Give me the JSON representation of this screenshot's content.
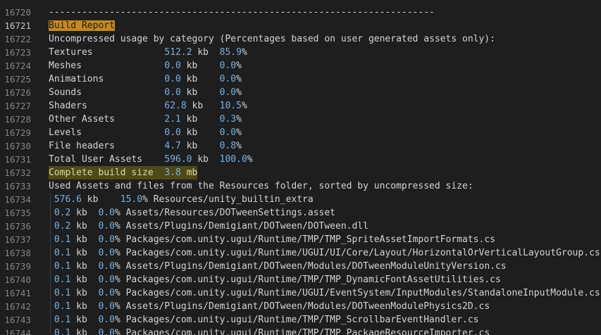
{
  "editor": {
    "lines": [
      {
        "n": "16720",
        "segments": [
          {
            "t": "----------------------------------------------------------------------",
            "c": "plain"
          }
        ]
      },
      {
        "n": "16721",
        "active": true,
        "segments": [
          {
            "t": "Build Report",
            "c": "highlight-word"
          }
        ]
      },
      {
        "n": "16722",
        "segments": [
          {
            "t": "Uncompressed usage by category (Percentages based on user generated assets only):",
            "c": "plain"
          }
        ]
      },
      {
        "n": "16723",
        "segments": [
          {
            "t": "Textures             ",
            "c": "plain"
          },
          {
            "t": "512.2",
            "c": "num"
          },
          {
            "t": " kb  ",
            "c": "plain"
          },
          {
            "t": "85.9",
            "c": "pct"
          },
          {
            "t": "%",
            "c": "plain"
          }
        ]
      },
      {
        "n": "16724",
        "segments": [
          {
            "t": "Meshes               ",
            "c": "plain"
          },
          {
            "t": "0.0",
            "c": "num"
          },
          {
            "t": " kb    ",
            "c": "plain"
          },
          {
            "t": "0.0",
            "c": "pct"
          },
          {
            "t": "%",
            "c": "plain"
          }
        ]
      },
      {
        "n": "16725",
        "segments": [
          {
            "t": "Animations           ",
            "c": "plain"
          },
          {
            "t": "0.0",
            "c": "num"
          },
          {
            "t": " kb    ",
            "c": "plain"
          },
          {
            "t": "0.0",
            "c": "pct"
          },
          {
            "t": "%",
            "c": "plain"
          }
        ]
      },
      {
        "n": "16726",
        "segments": [
          {
            "t": "Sounds               ",
            "c": "plain"
          },
          {
            "t": "0.0",
            "c": "num"
          },
          {
            "t": " kb    ",
            "c": "plain"
          },
          {
            "t": "0.0",
            "c": "pct"
          },
          {
            "t": "%",
            "c": "plain"
          }
        ]
      },
      {
        "n": "16727",
        "segments": [
          {
            "t": "Shaders              ",
            "c": "plain"
          },
          {
            "t": "62.8",
            "c": "num"
          },
          {
            "t": " kb   ",
            "c": "plain"
          },
          {
            "t": "10.5",
            "c": "pct"
          },
          {
            "t": "%",
            "c": "plain"
          }
        ]
      },
      {
        "n": "16728",
        "segments": [
          {
            "t": "Other Assets         ",
            "c": "plain"
          },
          {
            "t": "2.1",
            "c": "num"
          },
          {
            "t": " kb    ",
            "c": "plain"
          },
          {
            "t": "0.3",
            "c": "pct"
          },
          {
            "t": "%",
            "c": "plain"
          }
        ]
      },
      {
        "n": "16729",
        "segments": [
          {
            "t": "Levels               ",
            "c": "plain"
          },
          {
            "t": "0.0",
            "c": "num"
          },
          {
            "t": " kb    ",
            "c": "plain"
          },
          {
            "t": "0.0",
            "c": "pct"
          },
          {
            "t": "%",
            "c": "plain"
          }
        ]
      },
      {
        "n": "16730",
        "segments": [
          {
            "t": "File headers         ",
            "c": "plain"
          },
          {
            "t": "4.7",
            "c": "num"
          },
          {
            "t": " kb    ",
            "c": "plain"
          },
          {
            "t": "0.8",
            "c": "pct"
          },
          {
            "t": "%",
            "c": "plain"
          }
        ]
      },
      {
        "n": "16731",
        "segments": [
          {
            "t": "Total User Assets    ",
            "c": "plain"
          },
          {
            "t": "596.0",
            "c": "num"
          },
          {
            "t": " kb  ",
            "c": "plain"
          },
          {
            "t": "100.0",
            "c": "pct"
          },
          {
            "t": "%",
            "c": "plain"
          }
        ]
      },
      {
        "n": "16732",
        "find": true,
        "segments": [
          {
            "t": "Complete build size  ",
            "c": "yellowtxt"
          },
          {
            "t": "3.8",
            "c": "num"
          },
          {
            "t": " mb",
            "c": "yellowtxt"
          }
        ]
      },
      {
        "n": "16733",
        "segments": [
          {
            "t": "Used Assets and files from the Resources folder, sorted by uncompressed size:",
            "c": "plain"
          }
        ]
      },
      {
        "n": "16734",
        "segments": [
          {
            "t": " ",
            "c": "plain"
          },
          {
            "t": "576.6",
            "c": "num"
          },
          {
            "t": " kb    ",
            "c": "plain"
          },
          {
            "t": "15.0",
            "c": "pct"
          },
          {
            "t": "% Resources/unity_builtin_extra",
            "c": "plain"
          }
        ]
      },
      {
        "n": "16735",
        "segments": [
          {
            "t": " ",
            "c": "plain"
          },
          {
            "t": "0.2",
            "c": "num"
          },
          {
            "t": " kb  ",
            "c": "plain"
          },
          {
            "t": "0.0",
            "c": "pct"
          },
          {
            "t": "% Assets/Resources/DOTweenSettings.asset",
            "c": "plain"
          }
        ]
      },
      {
        "n": "16736",
        "segments": [
          {
            "t": " ",
            "c": "plain"
          },
          {
            "t": "0.2",
            "c": "num"
          },
          {
            "t": " kb  ",
            "c": "plain"
          },
          {
            "t": "0.0",
            "c": "pct"
          },
          {
            "t": "% Assets/Plugins/Demigiant/DOTween/DOTween.dll",
            "c": "plain"
          }
        ]
      },
      {
        "n": "16737",
        "segments": [
          {
            "t": " ",
            "c": "plain"
          },
          {
            "t": "0.1",
            "c": "num"
          },
          {
            "t": " kb  ",
            "c": "plain"
          },
          {
            "t": "0.0",
            "c": "pct"
          },
          {
            "t": "% Packages/com.unity.ugui/Runtime/TMP/TMP_SpriteAssetImportFormats.cs",
            "c": "plain"
          }
        ]
      },
      {
        "n": "16738",
        "segments": [
          {
            "t": " ",
            "c": "plain"
          },
          {
            "t": "0.1",
            "c": "num"
          },
          {
            "t": " kb  ",
            "c": "plain"
          },
          {
            "t": "0.0",
            "c": "pct"
          },
          {
            "t": "% Packages/com.unity.ugui/Runtime/UGUI/UI/Core/Layout/HorizontalOrVerticalLayoutGroup.cs",
            "c": "plain"
          }
        ]
      },
      {
        "n": "16739",
        "segments": [
          {
            "t": " ",
            "c": "plain"
          },
          {
            "t": "0.1",
            "c": "num"
          },
          {
            "t": " kb  ",
            "c": "plain"
          },
          {
            "t": "0.0",
            "c": "pct"
          },
          {
            "t": "% Assets/Plugins/Demigiant/DOTween/Modules/DOTweenModuleUnityVersion.cs",
            "c": "plain"
          }
        ]
      },
      {
        "n": "16740",
        "segments": [
          {
            "t": " ",
            "c": "plain"
          },
          {
            "t": "0.1",
            "c": "num"
          },
          {
            "t": " kb  ",
            "c": "plain"
          },
          {
            "t": "0.0",
            "c": "pct"
          },
          {
            "t": "% Packages/com.unity.ugui/Runtime/TMP/TMP_DynamicFontAssetUtilities.cs",
            "c": "plain"
          }
        ]
      },
      {
        "n": "16741",
        "segments": [
          {
            "t": " ",
            "c": "plain"
          },
          {
            "t": "0.1",
            "c": "num"
          },
          {
            "t": " kb  ",
            "c": "plain"
          },
          {
            "t": "0.0",
            "c": "pct"
          },
          {
            "t": "% Packages/com.unity.ugui/Runtime/UGUI/EventSystem/InputModules/StandaloneInputModule.cs",
            "c": "plain"
          }
        ]
      },
      {
        "n": "16742",
        "segments": [
          {
            "t": " ",
            "c": "plain"
          },
          {
            "t": "0.1",
            "c": "num"
          },
          {
            "t": " kb  ",
            "c": "plain"
          },
          {
            "t": "0.0",
            "c": "pct"
          },
          {
            "t": "% Assets/Plugins/Demigiant/DOTween/Modules/DOTweenModulePhysics2D.cs",
            "c": "plain"
          }
        ]
      },
      {
        "n": "16743",
        "segments": [
          {
            "t": " ",
            "c": "plain"
          },
          {
            "t": "0.1",
            "c": "num"
          },
          {
            "t": " kb  ",
            "c": "plain"
          },
          {
            "t": "0.0",
            "c": "pct"
          },
          {
            "t": "% Packages/com.unity.ugui/Runtime/TMP/TMP_ScrollbarEventHandler.cs",
            "c": "plain"
          }
        ]
      },
      {
        "n": "16744",
        "segments": [
          {
            "t": " ",
            "c": "plain"
          },
          {
            "t": "0.1",
            "c": "num"
          },
          {
            "t": " kb  ",
            "c": "plain"
          },
          {
            "t": "0.0",
            "c": "pct"
          },
          {
            "t": "% Packages/com.unity.ugui/Runtime/TMP/TMP_PackageResourceImporter.cs",
            "c": "plain"
          }
        ]
      }
    ]
  }
}
